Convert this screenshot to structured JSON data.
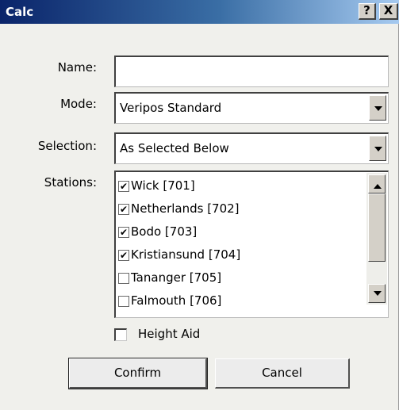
{
  "window": {
    "title": "Calc",
    "help_label": "?",
    "close_label": "X"
  },
  "form": {
    "name_label": "Name:",
    "name_value": "",
    "mode_label": "Mode:",
    "mode_value": "Veripos Standard",
    "selection_label": "Selection:",
    "selection_value": "As Selected Below",
    "stations_label": "Stations:"
  },
  "stations": [
    {
      "label": "Wick [701]",
      "checked": true
    },
    {
      "label": "Netherlands [702]",
      "checked": true
    },
    {
      "label": "Bodo [703]",
      "checked": true
    },
    {
      "label": "Kristiansund [704]",
      "checked": true
    },
    {
      "label": "Tananger [705]",
      "checked": false
    },
    {
      "label": "Falmouth [706]",
      "checked": false
    }
  ],
  "height_aid": {
    "label": "Height Aid",
    "checked": false
  },
  "buttons": {
    "confirm": "Confirm",
    "cancel": "Cancel"
  },
  "icons": {
    "check": "checkmark-icon",
    "down": "arrow-down-icon",
    "up": "arrow-up-icon"
  }
}
